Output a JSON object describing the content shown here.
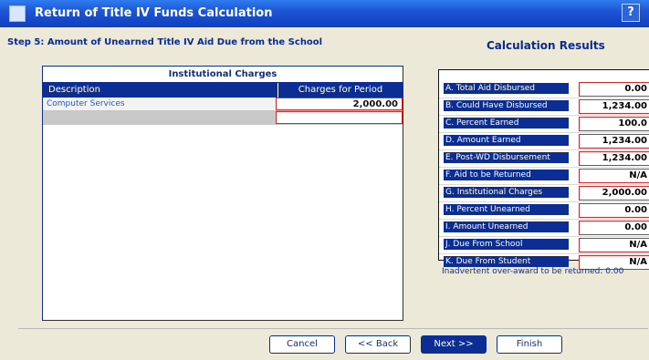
{
  "window": {
    "title": "Return of Title IV Funds Calculation",
    "help_label": "?"
  },
  "step": {
    "label": "Step 5: Amount of Unearned Title IV Aid Due from the School"
  },
  "charges": {
    "title": "Institutional Charges",
    "columns": [
      "Description",
      "Charges for Period"
    ],
    "rows": [
      {
        "description": "Computer Services",
        "amount": "2,000.00"
      },
      {
        "description": "",
        "amount": ""
      }
    ]
  },
  "calculation": {
    "title": "Calculation Results",
    "items": [
      {
        "label": "A. Total Aid Disbursed",
        "value": "0.00"
      },
      {
        "label": "B. Could Have Disbursed",
        "value": "1,234.00"
      },
      {
        "label": "C. Percent Earned",
        "value": "100.0"
      },
      {
        "label": "D. Amount Earned",
        "value": "1,234.00"
      },
      {
        "label": "E. Post-WD Disbursement",
        "value": "1,234.00"
      },
      {
        "label": "F. Aid to be Returned",
        "value": "N/A"
      },
      {
        "label": "G. Institutional Charges",
        "value": "2,000.00"
      },
      {
        "label": "H. Percent Unearned",
        "value": "0.00"
      },
      {
        "label": "I. Amount Unearned",
        "value": "0.00"
      },
      {
        "label": "J. Due From School",
        "value": "N/A"
      },
      {
        "label": "K. Due From Student",
        "value": "N/A"
      }
    ],
    "inadvertent_label": "Inadvertent over-award to be returned:",
    "inadvertent_value": "0.00"
  },
  "buttons": {
    "cancel": "Cancel",
    "back": "<< Back",
    "next": "Next >>",
    "finish": "Finish"
  }
}
